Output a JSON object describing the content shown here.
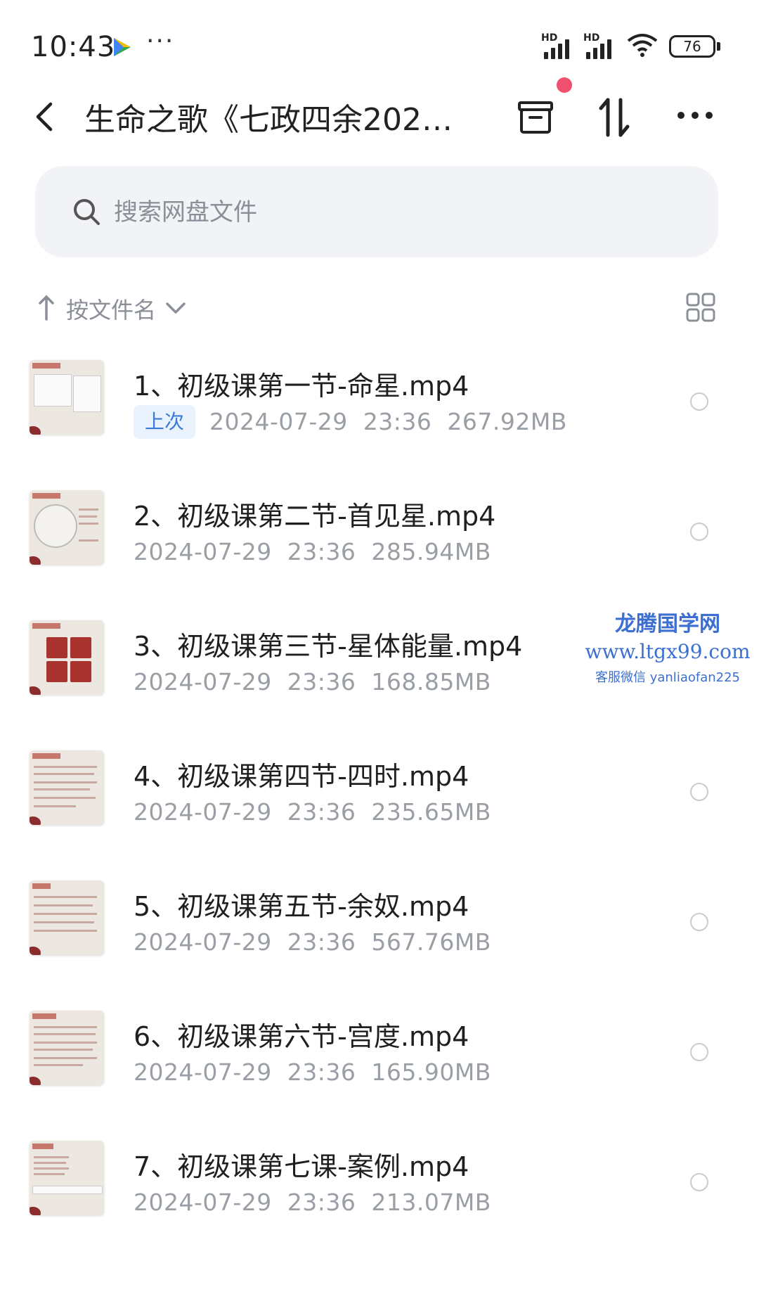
{
  "status": {
    "time": "10:43",
    "battery": "76",
    "hd1": "HD",
    "hd2": "HD"
  },
  "nav": {
    "title": "生命之歌《七政四余202…"
  },
  "search": {
    "placeholder": "搜索网盘文件"
  },
  "sortbar": {
    "label": "按文件名"
  },
  "files": [
    {
      "name": "1、初级课第一节-命星.mp4",
      "badge": "上次",
      "date": "2024-07-29",
      "time": "23:36",
      "size": "267.92MB"
    },
    {
      "name": "2、初级课第二节-首见星.mp4",
      "date": "2024-07-29",
      "time": "23:36",
      "size": "285.94MB"
    },
    {
      "name": "3、初级课第三节-星体能量.mp4",
      "date": "2024-07-29",
      "time": "23:36",
      "size": "168.85MB"
    },
    {
      "name": "4、初级课第四节-四时.mp4",
      "date": "2024-07-29",
      "time": "23:36",
      "size": "235.65MB"
    },
    {
      "name": "5、初级课第五节-余奴.mp4",
      "date": "2024-07-29",
      "time": "23:36",
      "size": "567.76MB"
    },
    {
      "name": "6、初级课第六节-宫度.mp4",
      "date": "2024-07-29",
      "time": "23:36",
      "size": "165.90MB"
    },
    {
      "name": "7、初级课第七课-案例.mp4",
      "date": "2024-07-29",
      "time": "23:36",
      "size": "213.07MB"
    }
  ],
  "watermark": {
    "line1": "龙腾国学网",
    "line2": "www.ltgx99.com",
    "line3": "客服微信 yanliaofan225"
  },
  "colors": {
    "accent": "#3a7bd5",
    "notification": "#f0506e",
    "search_bg": "#f1f3f6"
  }
}
